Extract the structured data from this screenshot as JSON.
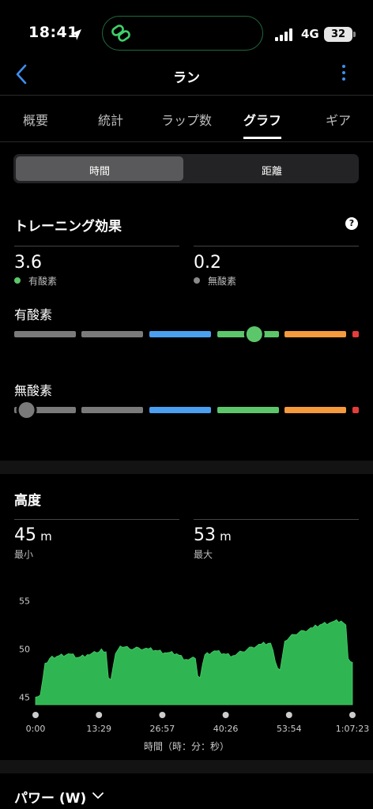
{
  "status": {
    "time": "18:41",
    "network": "4G",
    "battery": "32"
  },
  "header": {
    "title": "ラン"
  },
  "tabs": [
    "概要",
    "統計",
    "ラップ数",
    "グラフ",
    "ギア"
  ],
  "segment": {
    "left": "時間",
    "right": "距離",
    "selected": "時間"
  },
  "training": {
    "title": "トレーニング効果",
    "help": "?",
    "aerobic_value": "3.6",
    "aerobic_label": "有酸素",
    "anaerobic_value": "0.2",
    "anaerobic_label": "無酸素",
    "aerobic_bar_label": "有酸素",
    "anaerobic_bar_label": "無酸素",
    "aerobic_level": 3.6,
    "anaerobic_level": 0.2,
    "colors": {
      "gray": "#7a7a7a",
      "blue": "#4a9ff0",
      "green": "#5cc76a",
      "orange": "#f59a3d",
      "red": "#e63c3c"
    }
  },
  "elevation": {
    "title": "高度",
    "min_value": "45",
    "min_unit": "m",
    "min_label": "最小",
    "max_value": "53",
    "max_unit": "m",
    "max_label": "最大"
  },
  "chart_data": {
    "type": "area",
    "xlabel": "時間（時：分：秒）",
    "ylabel": "",
    "ylim": [
      44.2,
      55.2
    ],
    "y_ticks": [
      "55",
      "50",
      "45"
    ],
    "x_ticks": [
      "0:00",
      "13:29",
      "26:57",
      "40:26",
      "53:54",
      "1:07:23"
    ],
    "x_minutes": [
      0,
      1,
      2,
      3,
      5,
      7,
      9,
      11,
      13,
      14,
      15,
      15.5,
      16,
      17,
      18,
      20,
      22,
      24,
      26,
      28,
      30,
      32,
      34,
      34.5,
      35,
      36,
      38,
      40,
      42,
      44,
      46,
      48,
      50,
      51.5,
      52,
      53,
      55,
      57,
      59,
      61,
      63,
      65,
      66,
      66.5,
      67.4
    ],
    "values": [
      45.0,
      45.2,
      48.5,
      49.0,
      49.3,
      49.5,
      49.1,
      49.4,
      49.6,
      50.0,
      49.7,
      47.0,
      46.8,
      49.5,
      50.3,
      50.0,
      50.1,
      50.0,
      49.8,
      49.6,
      49.5,
      48.9,
      49.0,
      47.2,
      47.0,
      49.4,
      49.8,
      49.5,
      49.3,
      49.7,
      50.2,
      50.5,
      50.6,
      48.0,
      47.8,
      50.8,
      51.5,
      51.9,
      52.2,
      52.6,
      52.8,
      52.9,
      52.5,
      49.0,
      48.6
    ],
    "color": "#2fb552"
  },
  "power": {
    "title": "パワー (W)"
  }
}
